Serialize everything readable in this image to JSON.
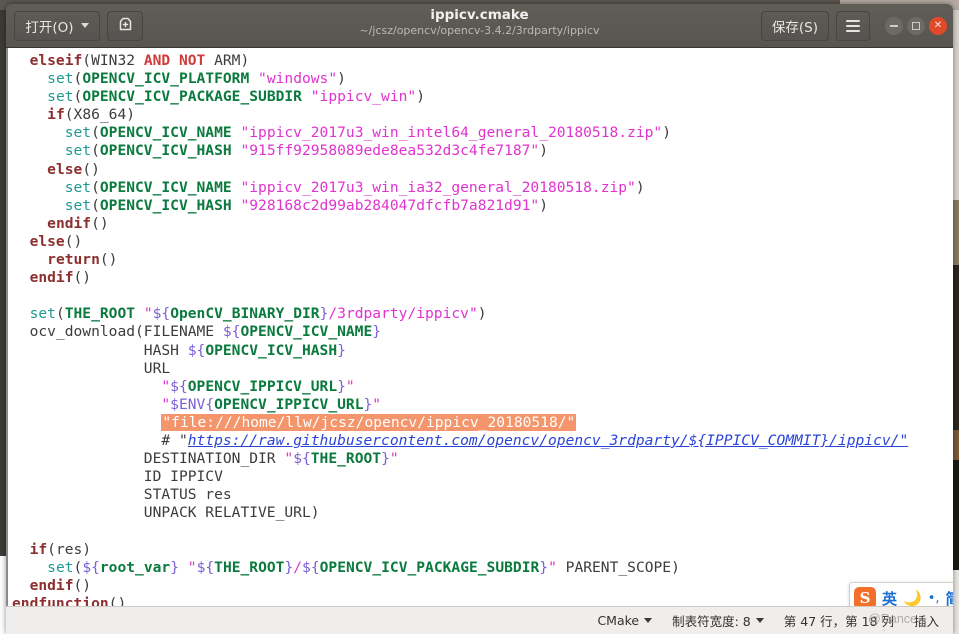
{
  "window": {
    "title": "ippicv.cmake",
    "path": "~/jcsz/opencv/opencv-3.4.2/3rdparty/ippicv"
  },
  "header": {
    "open_label": "打开(O)",
    "new_tab_icon": "new-document-icon",
    "save_label": "保存(S)",
    "menu_icon": "hamburger-menu-icon",
    "minimize_icon": "minimize-icon",
    "maximize_icon": "maximize-icon",
    "close_icon": "close-icon"
  },
  "editor": {
    "lines": [
      "  elseif(WIN32 AND NOT ARM)",
      "    set(OPENCV_ICV_PLATFORM \"windows\")",
      "    set(OPENCV_ICV_PACKAGE_SUBDIR \"ippicv_win\")",
      "    if(X86_64)",
      "      set(OPENCV_ICV_NAME \"ippicv_2017u3_win_intel64_general_20180518.zip\")",
      "      set(OPENCV_ICV_HASH \"915ff92958089ede8ea532d3c4fe7187\")",
      "    else()",
      "      set(OPENCV_ICV_NAME \"ippicv_2017u3_win_ia32_general_20180518.zip\")",
      "      set(OPENCV_ICV_HASH \"928168c2d99ab284047dfcfb7a821d91\")",
      "    endif()",
      "  else()",
      "    return()",
      "  endif()",
      "",
      "  set(THE_ROOT \"${OpenCV_BINARY_DIR}/3rdparty/ippicv\")",
      "  ocv_download(FILENAME ${OPENCV_ICV_NAME}",
      "               HASH ${OPENCV_ICV_HASH}",
      "               URL",
      "                 \"${OPENCV_IPPICV_URL}\"",
      "                 \"$ENV{OPENCV_IPPICV_URL}\"",
      "                 \"file:///home/llw/jcsz/opencv/ippicv_20180518/\"",
      "                 # \"https://raw.githubusercontent.com/opencv/opencv_3rdparty/${IPPICV_COMMIT}/ippicv/\"",
      "               DESTINATION_DIR \"${THE_ROOT}\"",
      "               ID IPPICV",
      "               STATUS res",
      "               UNPACK RELATIVE_URL)",
      "",
      "  if(res)",
      "    set(${root_var} \"${THE_ROOT}/${OPENCV_ICV_PACKAGE_SUBDIR}\" PARENT_SCOPE)",
      "  endif()",
      "endfunction()"
    ],
    "highlighted_line_text": "\"file:///home/llw/jcsz/opencv/ippicv_20180518/\"",
    "comment_url": "https://raw.githubusercontent.com/opencv/opencv_3rdparty/${IPPICV_COMMIT}/ippicv/"
  },
  "status_bar": {
    "language": "CMake",
    "tab_width_label": "制表符宽度: 8",
    "cursor_position": "第 47 行，第 18 列",
    "insert_mode": "插入",
    "watermark": "@Rance"
  },
  "ime": {
    "logo": "S",
    "mode": "英",
    "moon_icon": "moon-icon",
    "punctuation_icon": "punctuation-icon",
    "script": "简"
  },
  "colors": {
    "accent_highlight": "#f4956b",
    "keyword": "#8d2f2f",
    "function": "#1f9a93",
    "variable": "#0b7a3e",
    "string": "#e033cf",
    "link": "#2b44d8",
    "close_button": "#e0492a",
    "header_bg": "#585450"
  }
}
